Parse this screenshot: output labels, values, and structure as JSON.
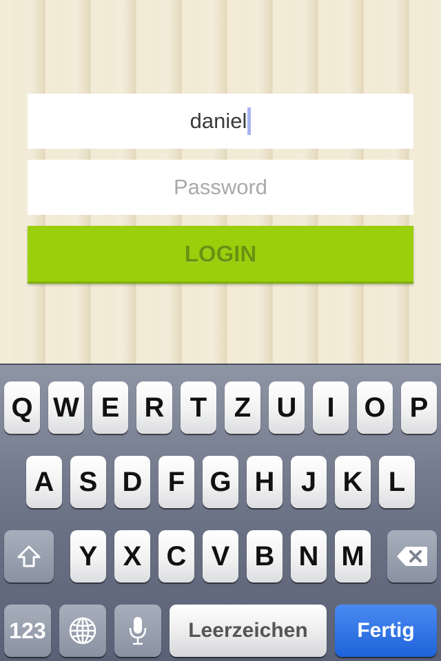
{
  "form": {
    "username_value": "daniel",
    "password_placeholder": "Password",
    "login_label": "LOGIN"
  },
  "keyboard": {
    "row1": [
      "Q",
      "W",
      "E",
      "R",
      "T",
      "Z",
      "U",
      "I",
      "O",
      "P"
    ],
    "row2": [
      "A",
      "S",
      "D",
      "F",
      "G",
      "H",
      "J",
      "K",
      "L"
    ],
    "row3": [
      "Y",
      "X",
      "C",
      "V",
      "B",
      "N",
      "M"
    ],
    "numbers_label": "123",
    "space_label": "Leerzeichen",
    "return_label": "Fertig",
    "icons": {
      "shift": "shift-icon",
      "delete": "backspace-icon",
      "globe": "globe-icon",
      "dictation": "microphone-icon"
    }
  },
  "colors": {
    "login_button": "#99cf0b",
    "return_key": "#1f63d9"
  }
}
